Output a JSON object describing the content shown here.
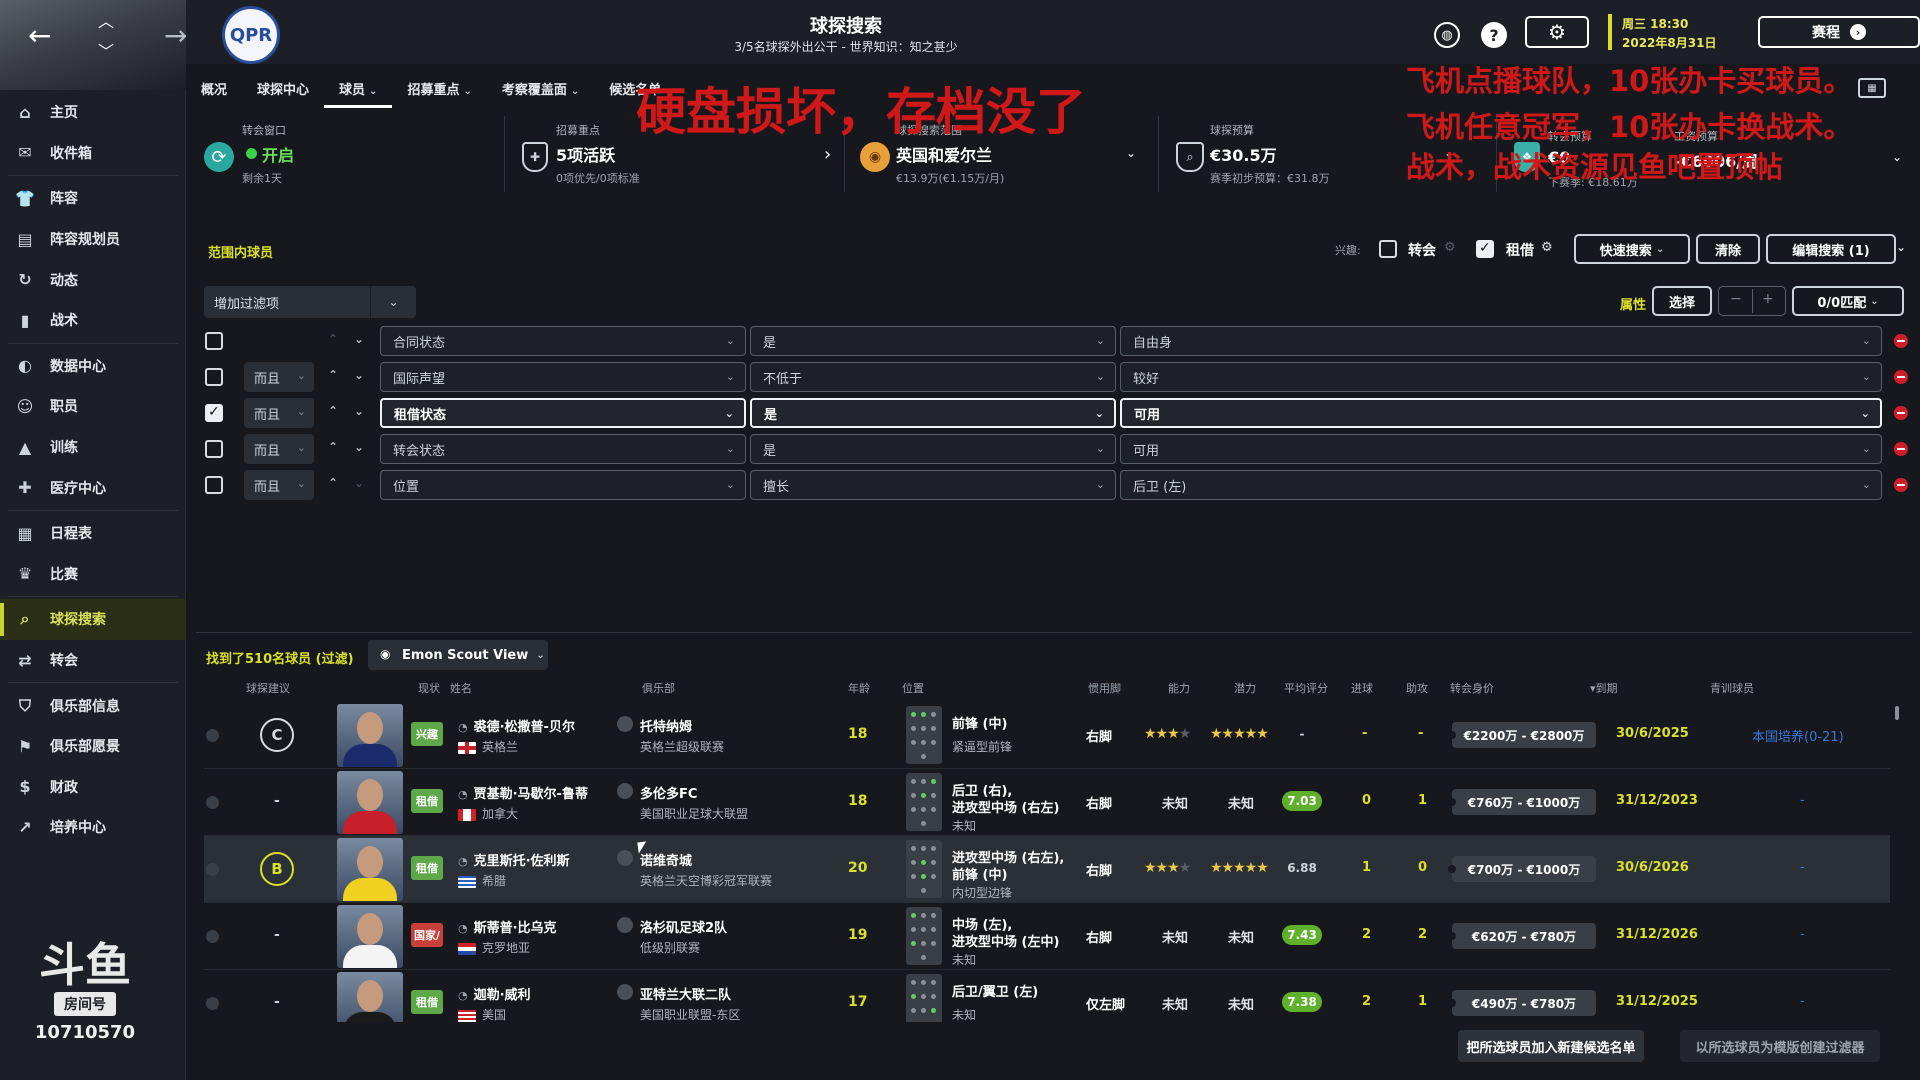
{
  "header": {
    "title": "球探搜索",
    "subtitle": "3/5名球探外出公干 - 世界知识：知之甚少",
    "date_day": "周三 18:30",
    "date_full": "2022年8月31日",
    "continue_label": "赛程",
    "club_badge": "QPR"
  },
  "sidebar": {
    "items": [
      {
        "label": "主页",
        "icon": "home-icon"
      },
      {
        "label": "收件箱",
        "icon": "inbox-icon"
      },
      {
        "label": "阵容",
        "icon": "squad-icon"
      },
      {
        "label": "阵容规划员",
        "icon": "planner-icon"
      },
      {
        "label": "动态",
        "icon": "dynamics-icon"
      },
      {
        "label": "战术",
        "icon": "tactics-icon"
      },
      {
        "label": "数据中心",
        "icon": "data-hub-icon"
      },
      {
        "label": "职员",
        "icon": "staff-icon"
      },
      {
        "label": "训练",
        "icon": "training-icon"
      },
      {
        "label": "医疗中心",
        "icon": "medical-icon"
      },
      {
        "label": "日程表",
        "icon": "schedule-icon"
      },
      {
        "label": "比赛",
        "icon": "trophy-icon"
      },
      {
        "label": "球探搜索",
        "icon": "search-icon"
      },
      {
        "label": "转会",
        "icon": "transfer-icon"
      },
      {
        "label": "俱乐部信息",
        "icon": "club-info-icon"
      },
      {
        "label": "俱乐部愿景",
        "icon": "vision-icon"
      },
      {
        "label": "财政",
        "icon": "finance-icon"
      },
      {
        "label": "培养中心",
        "icon": "development-icon"
      }
    ],
    "logo_main": "斗鱼",
    "logo_room": "房间号",
    "logo_number": "10710570"
  },
  "tabs": [
    {
      "label": "概况",
      "dropdown": false
    },
    {
      "label": "球探中心",
      "dropdown": false
    },
    {
      "label": "球员",
      "dropdown": true
    },
    {
      "label": "招募重点",
      "dropdown": true
    },
    {
      "label": "考察覆盖面",
      "dropdown": true
    },
    {
      "label": "候选名单",
      "dropdown": true
    }
  ],
  "info": {
    "window_label": "转会窗口",
    "window_value": "开启",
    "window_sub": "剩余1天",
    "focus_label": "招募重点",
    "focus_value": "5项活跃",
    "focus_sub": "0项优先/0项标准",
    "range_label": "球探搜索范围",
    "range_value": "英国和爱尔兰",
    "range_sub": "€13.9万(€1.15万/月)",
    "budget_label": "球探预算",
    "budget_value": "€30.5万",
    "budget_sub": "赛季初步预算：€31.8万",
    "transfer_label": "转会预算",
    "transfer_value": "€0",
    "wage_label": "工资预算",
    "wage_value": "-€6006/周",
    "wage_sub": "下赛季: €18.61万"
  },
  "overlay": {
    "line1": "硬盘损坏，存档没了",
    "line2": "飞机点播球队，10张办卡买球员。",
    "line3": "飞机任意冠军，10张办卡换战术。",
    "line4": "战术，战术资源见鱼吧置顶帖"
  },
  "section": {
    "title": "范围内球员",
    "interest_label": "兴趣:",
    "transfer_label": "转会",
    "loan_label": "租借",
    "quick_search": "快速搜索",
    "clear": "清除",
    "edit_search": "编辑搜索 (1)",
    "attributes_label": "属性",
    "select": "选择",
    "match": "0/0匹配"
  },
  "filters": {
    "add_filter": "增加过滤项",
    "rows": [
      {
        "checked": false,
        "and": "",
        "field": "合同状态",
        "op": "是",
        "value": "自由身",
        "highlight": false
      },
      {
        "checked": false,
        "and": "而且",
        "field": "国际声望",
        "op": "不低于",
        "value": "较好",
        "highlight": false
      },
      {
        "checked": true,
        "and": "而且",
        "field": "租借状态",
        "op": "是",
        "value": "可用",
        "highlight": true
      },
      {
        "checked": false,
        "and": "而且",
        "field": "转会状态",
        "op": "是",
        "value": "可用",
        "highlight": false
      },
      {
        "checked": false,
        "and": "而且",
        "field": "位置",
        "op": "擅长",
        "value": "后卫 (左)",
        "highlight": false
      }
    ]
  },
  "results": {
    "count_label": "找到了510名球员 (过滤)",
    "view_label": "Emon Scout View",
    "columns": [
      "球探建议",
      "现状",
      "姓名",
      "俱乐部",
      "年龄",
      "位置",
      "惯用脚",
      "能力",
      "潜力",
      "平均评分",
      "进球",
      "助攻",
      "转会身价",
      "▾到期",
      "青训球员"
    ],
    "players": [
      {
        "rec": "C",
        "rec_color": "plain",
        "status": "兴趣",
        "status_color": "#5fa84a",
        "name": "裘德·松撒普-贝尔",
        "nation": "英格兰",
        "flag": "england",
        "club": "托特纳姆",
        "league": "英格兰超级联赛",
        "age": "18",
        "pos1": "前锋 (中)",
        "pos2": "",
        "role": "紧逼型前锋",
        "foot": "右脚",
        "ability_stars": 2.5,
        "potential_stars": 4.5,
        "ability": "",
        "potential": "",
        "rating": "-",
        "goals": "-",
        "assists": "-",
        "value": "€2200万 - €2800万",
        "expiry": "30/6/2025",
        "youth": "本国培养(0-21)"
      },
      {
        "rec": "-",
        "rec_color": "none",
        "status": "租借",
        "status_color": "#5fa84a",
        "name": "贾基勒·马歇尔-鲁蒂",
        "nation": "加拿大",
        "flag": "canada",
        "club": "多伦多FC",
        "league": "美国职业足球大联盟",
        "age": "18",
        "pos1": "后卫 (右),",
        "pos2": "进攻型中场 (右左)",
        "role": "未知",
        "foot": "右脚",
        "ability_stars": 0,
        "potential_stars": 0,
        "ability": "未知",
        "potential": "未知",
        "rating": "7.03",
        "goals": "0",
        "assists": "1",
        "value": "€760万 - €1000万",
        "expiry": "31/12/2023",
        "youth": "-"
      },
      {
        "rec": "B",
        "rec_color": "yellow",
        "status": "租借",
        "status_color": "#5fa84a",
        "name": "克里斯托·佐利斯",
        "nation": "希腊",
        "flag": "greece",
        "club": "诺维奇城",
        "league": "英格兰天空博彩冠军联赛",
        "age": "20",
        "pos1": "进攻型中场 (右左),",
        "pos2": "前锋 (中)",
        "role": "内切型边锋",
        "foot": "右脚",
        "ability_stars": 2.5,
        "potential_stars": 4.5,
        "ability": "",
        "potential": "",
        "rating": "6.88",
        "goals": "1",
        "assists": "0",
        "value": "€700万 - €1000万",
        "expiry": "30/6/2026",
        "youth": "-"
      },
      {
        "rec": "-",
        "rec_color": "none",
        "status": "国家/",
        "status_color": "#c8403a",
        "name": "斯蒂普·比乌克",
        "nation": "克罗地亚",
        "flag": "croatia",
        "club": "洛杉矶足球2队",
        "league": "低级别联赛",
        "age": "19",
        "pos1": "中场 (左),",
        "pos2": "进攻型中场 (左中)",
        "role": "未知",
        "foot": "右脚",
        "ability_stars": 0,
        "potential_stars": 0,
        "ability": "未知",
        "potential": "未知",
        "rating": "7.43",
        "goals": "2",
        "assists": "2",
        "value": "€620万 - €780万",
        "expiry": "31/12/2026",
        "youth": "-"
      },
      {
        "rec": "-",
        "rec_color": "none",
        "status": "租借",
        "status_color": "#5fa84a",
        "name": "迦勒·威利",
        "nation": "美国",
        "flag": "usa",
        "club": "亚特兰大联二队",
        "league": "美国职业联盟-东区",
        "age": "17",
        "pos1": "后卫/翼卫 (左)",
        "pos2": "",
        "role": "未知",
        "foot": "仅左脚",
        "ability_stars": 0,
        "potential_stars": 0,
        "ability": "未知",
        "potential": "未知",
        "rating": "7.38",
        "goals": "2",
        "assists": "1",
        "value": "€490万 - €780万",
        "expiry": "31/12/2025",
        "youth": "-"
      }
    ]
  },
  "footer": {
    "add_shortlist": "把所选球员加入新建候选名单",
    "create_filter": "以所选球员为模版创建过滤器"
  }
}
